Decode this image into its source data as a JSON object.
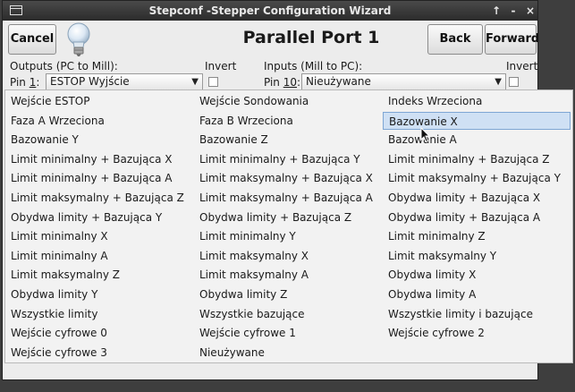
{
  "window": {
    "title": "Stepconf -Stepper Configuration Wizard",
    "controls": [
      "↑",
      "-",
      "×"
    ]
  },
  "toolbar": {
    "cancel_label": "Cancel",
    "heading": "Parallel Port 1",
    "back_label": "Back",
    "forward_label": "Forward"
  },
  "outputs": {
    "header": "Outputs (PC to Mill):",
    "invert_label": "Invert",
    "pin_label_prefix": "Pin ",
    "pin_number": "1",
    "pin_label_suffix": ":",
    "selected": "ESTOP Wyjście",
    "inverted": false
  },
  "inputs": {
    "header": "Inputs (Mill to PC):",
    "invert_label": "Invert",
    "pin_label_prefix": "Pin ",
    "pin_number": "10",
    "pin_label_suffix": ":",
    "selected": "Nieużywane",
    "inverted": false
  },
  "dropdown": {
    "highlighted": "Bazowanie X",
    "items": [
      "Wejście ESTOP",
      "Wejście Sondowania",
      "Indeks Wrzeciona",
      "Faza A Wrzeciona",
      "Faza B Wrzeciona",
      "Bazowanie X",
      "Bazowanie Y",
      "Bazowanie Z",
      "Bazowanie A",
      "Limit minimalny + Bazująca X",
      "Limit minimalny + Bazująca Y",
      "Limit minimalny + Bazująca Z",
      "Limit minimalny + Bazująca A",
      "Limit maksymalny + Bazująca X",
      "Limit maksymalny + Bazująca Y",
      "Limit maksymalny + Bazująca Z",
      "Limit maksymalny + Bazująca A",
      "Obydwa limity + Bazująca X",
      "Obydwa limity + Bazująca Y",
      "Obydwa limity + Bazująca Z",
      "Obydwa limity + Bazująca A",
      "Limit minimalny X",
      "Limit minimalny Y",
      "Limit minimalny Z",
      "Limit minimalny A",
      "Limit maksymalny X",
      "Limit maksymalny Y",
      "Limit maksymalny Z",
      "Limit maksymalny A",
      "Obydwa limity X",
      "Obydwa limity Y",
      "Obydwa limity Z",
      "Obydwa limity A",
      "Wszystkie limity",
      "Wszystkie bazujące",
      "Wszystkie limity i bazujące",
      "Wejście cyfrowe 0",
      "Wejście cyfrowe 1",
      "Wejście cyfrowe 2",
      "Wejście cyfrowe 3",
      "Nieużywane"
    ]
  },
  "colors": {
    "titlebar": "#2b2b2b",
    "highlight": "#cfe0f4",
    "highlight_border": "#7ea6d4"
  },
  "icons": [
    "menu-icon",
    "lightbulb-icon",
    "mouse-pointer-icon"
  ]
}
